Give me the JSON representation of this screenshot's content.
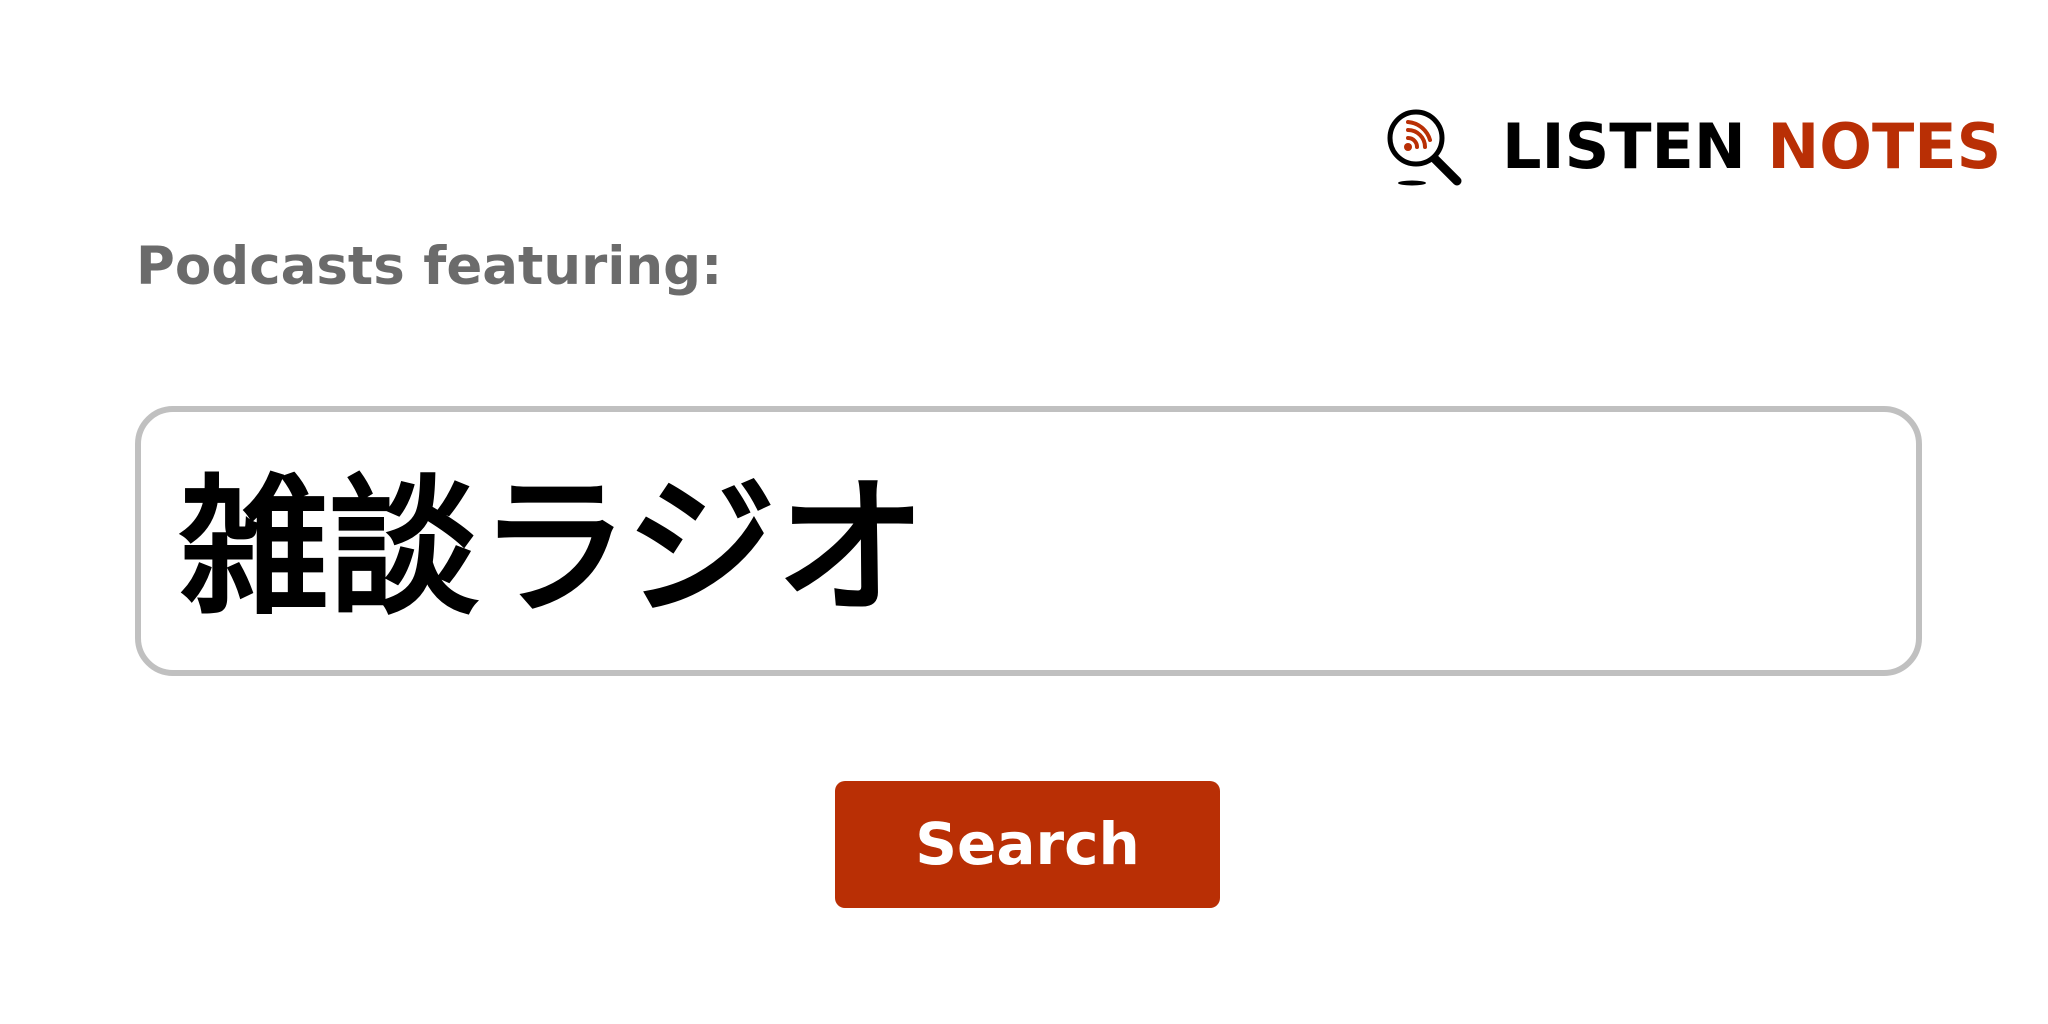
{
  "brand": {
    "name_part1": "LISTEN",
    "name_part2": "NOTES",
    "icon": "magnifier-podcast-signal-icon",
    "color_dark": "#000000",
    "color_accent": "#b92f05"
  },
  "heading": "Podcasts featuring:",
  "search": {
    "query": "雑談ラジオ"
  },
  "search_button": {
    "label": "Search",
    "color": "#b92f05"
  }
}
